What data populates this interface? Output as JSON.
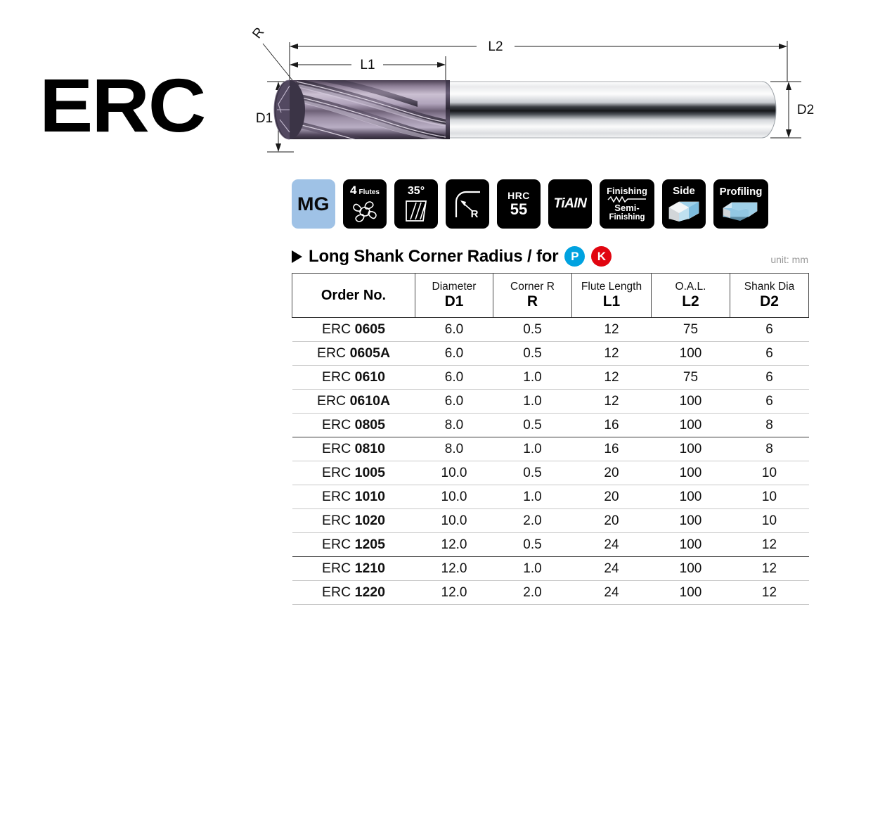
{
  "series": {
    "code": "ERC"
  },
  "drawing": {
    "labels": {
      "r": "R",
      "d1": "D1",
      "d2": "D2",
      "l1": "L1",
      "l2": "L2"
    }
  },
  "badges": [
    {
      "id": "mg",
      "type": "mg",
      "label": "MG"
    },
    {
      "id": "flutes",
      "type": "flutes",
      "count": "4",
      "word": "Flutes"
    },
    {
      "id": "helix",
      "type": "helix",
      "label": "35°"
    },
    {
      "id": "corner-r",
      "type": "corner-r",
      "label": "R"
    },
    {
      "id": "hardness",
      "type": "hardness",
      "top": "HRC",
      "value": "55"
    },
    {
      "id": "coating",
      "type": "coating",
      "label": "TiAlN"
    },
    {
      "id": "finishing",
      "type": "finishing",
      "line1": "Finishing",
      "line2": "Semi-",
      "line3": "Finishing"
    },
    {
      "id": "side",
      "type": "operation",
      "label": "Side"
    },
    {
      "id": "profiling",
      "type": "operation",
      "label": "Profiling"
    }
  ],
  "section": {
    "title": "Long Shank Corner Radius / for",
    "materials": [
      {
        "code": "P",
        "color": "#00A2E0"
      },
      {
        "code": "K",
        "color": "#E10510"
      }
    ],
    "unit": "unit: mm"
  },
  "table": {
    "headers": [
      {
        "sub": "",
        "code": "Order No.",
        "single": true
      },
      {
        "sub": "Diameter",
        "code": "D1"
      },
      {
        "sub": "Corner R",
        "code": "R"
      },
      {
        "sub": "Flute Length",
        "code": "L1"
      },
      {
        "sub": "O.A.L.",
        "code": "L2"
      },
      {
        "sub": "Shank Dia",
        "code": "D2"
      }
    ],
    "rows": [
      {
        "prefix": "ERC",
        "num": "0605",
        "d1": "6.0",
        "r": "0.5",
        "l1": "12",
        "l2": "75",
        "d2": "6",
        "thick": false
      },
      {
        "prefix": "ERC",
        "num": "0605A",
        "d1": "6.0",
        "r": "0.5",
        "l1": "12",
        "l2": "100",
        "d2": "6",
        "thick": false
      },
      {
        "prefix": "ERC",
        "num": "0610",
        "d1": "6.0",
        "r": "1.0",
        "l1": "12",
        "l2": "75",
        "d2": "6",
        "thick": false
      },
      {
        "prefix": "ERC",
        "num": "0610A",
        "d1": "6.0",
        "r": "1.0",
        "l1": "12",
        "l2": "100",
        "d2": "6",
        "thick": false
      },
      {
        "prefix": "ERC",
        "num": "0805",
        "d1": "8.0",
        "r": "0.5",
        "l1": "16",
        "l2": "100",
        "d2": "8",
        "thick": true
      },
      {
        "prefix": "ERC",
        "num": "0810",
        "d1": "8.0",
        "r": "1.0",
        "l1": "16",
        "l2": "100",
        "d2": "8",
        "thick": false
      },
      {
        "prefix": "ERC",
        "num": "1005",
        "d1": "10.0",
        "r": "0.5",
        "l1": "20",
        "l2": "100",
        "d2": "10",
        "thick": false
      },
      {
        "prefix": "ERC",
        "num": "1010",
        "d1": "10.0",
        "r": "1.0",
        "l1": "20",
        "l2": "100",
        "d2": "10",
        "thick": false
      },
      {
        "prefix": "ERC",
        "num": "1020",
        "d1": "10.0",
        "r": "2.0",
        "l1": "20",
        "l2": "100",
        "d2": "10",
        "thick": false
      },
      {
        "prefix": "ERC",
        "num": "1205",
        "d1": "12.0",
        "r": "0.5",
        "l1": "24",
        "l2": "100",
        "d2": "12",
        "thick": true
      },
      {
        "prefix": "ERC",
        "num": "1210",
        "d1": "12.0",
        "r": "1.0",
        "l1": "24",
        "l2": "100",
        "d2": "12",
        "thick": false
      },
      {
        "prefix": "ERC",
        "num": "1220",
        "d1": "12.0",
        "r": "2.0",
        "l1": "24",
        "l2": "100",
        "d2": "12",
        "thick": false
      }
    ]
  }
}
